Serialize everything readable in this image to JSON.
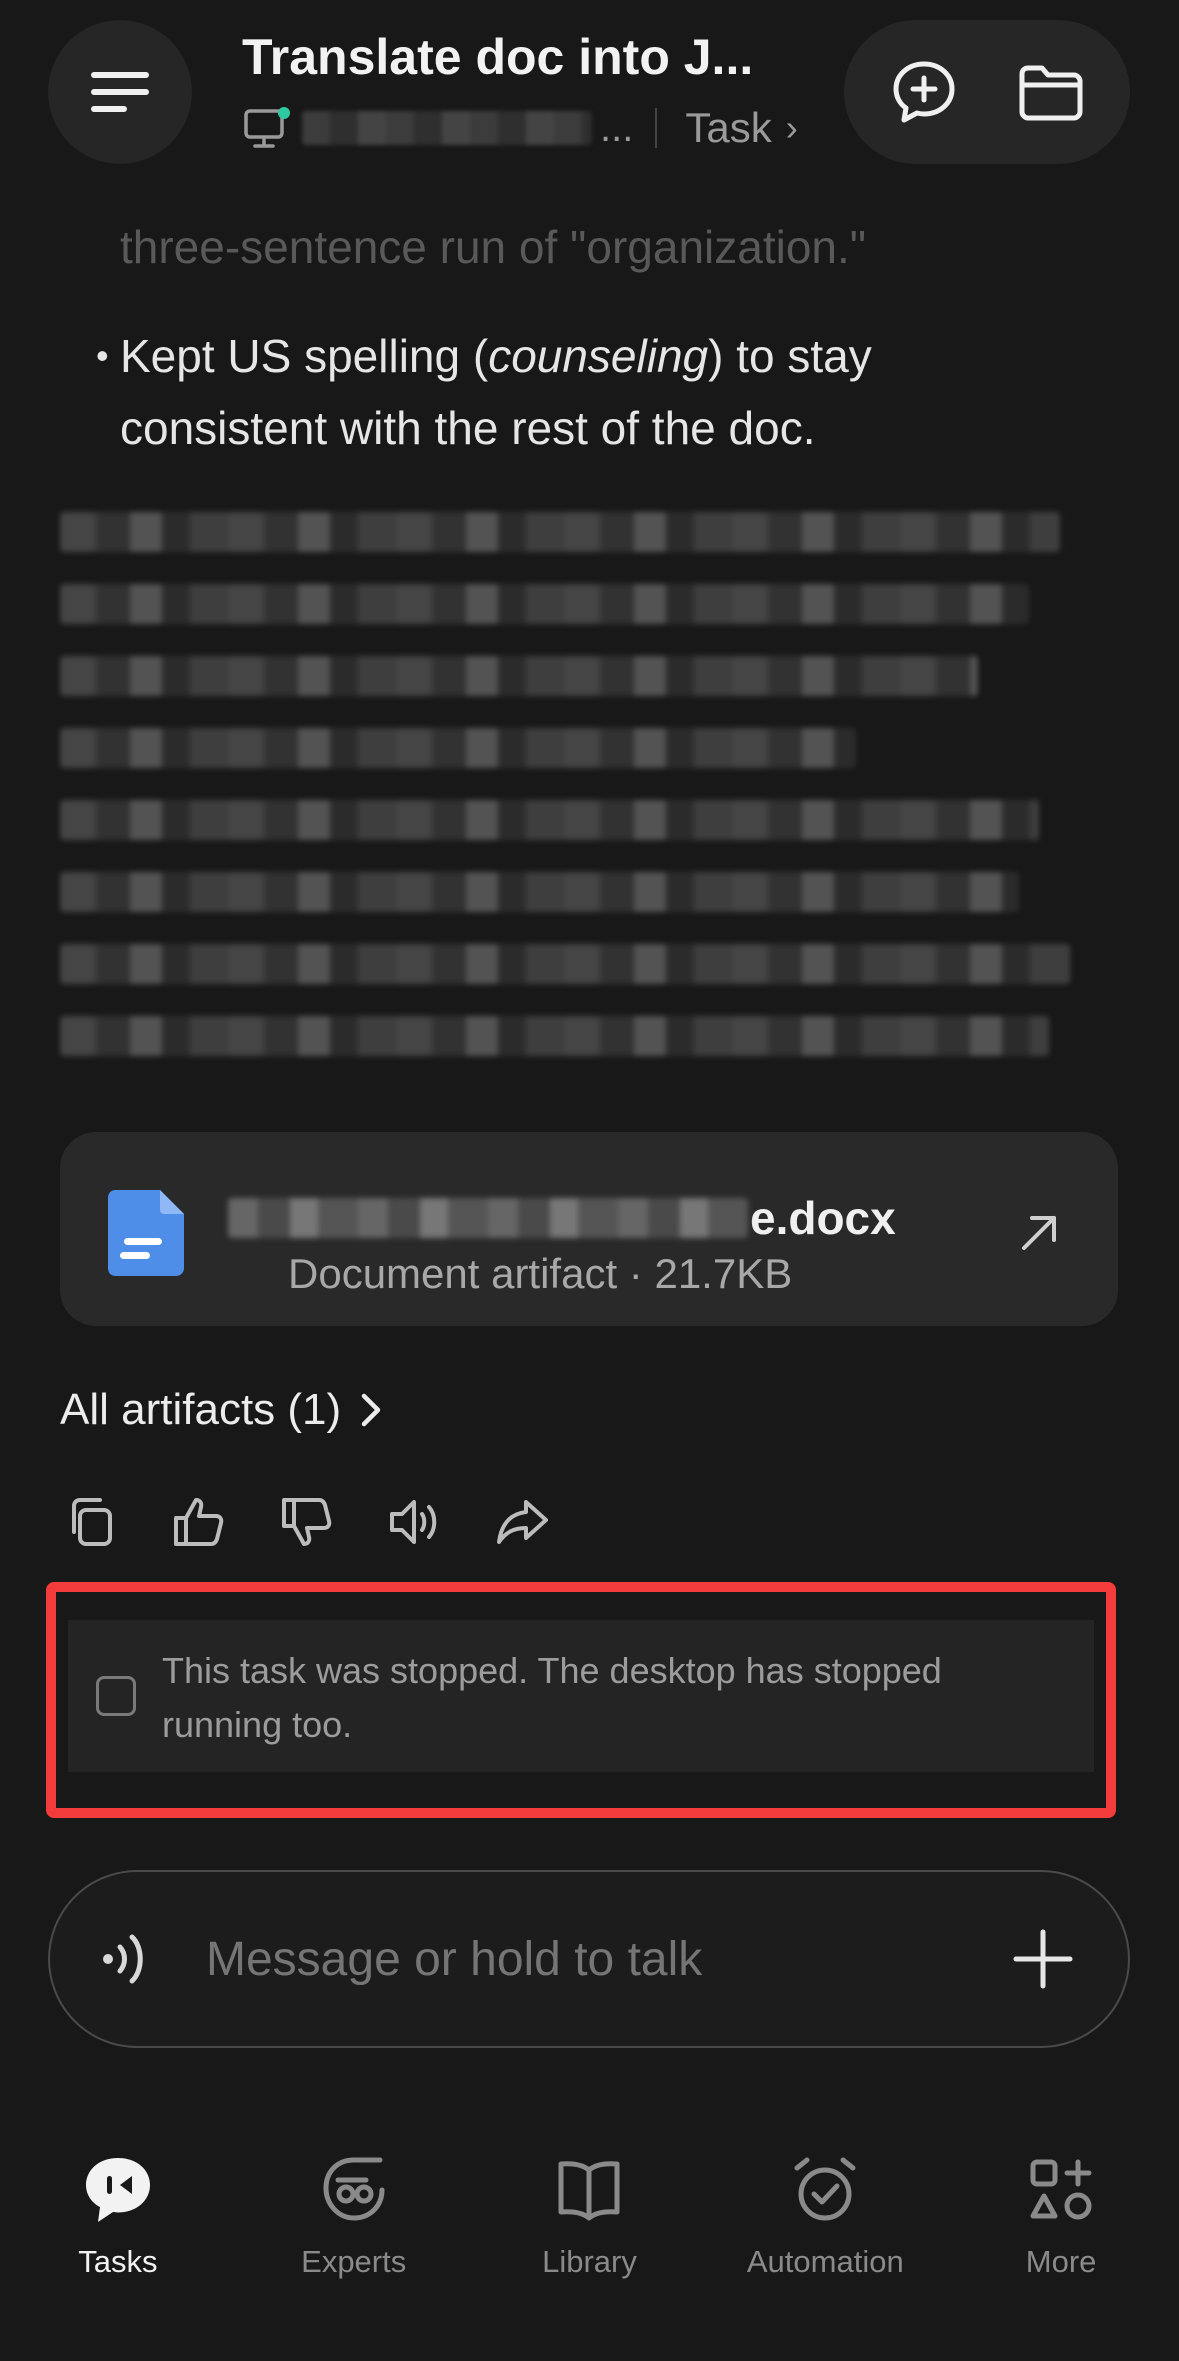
{
  "header": {
    "title": "Translate doc into J...",
    "subtitle_ellipsis": "...",
    "subtitle_task": "Task"
  },
  "message": {
    "faded_line": "three-sentence run of \"organization.\"",
    "bullet": {
      "before": "Kept US spelling (",
      "italic": "counseling",
      "after": ") to stay consistent with the rest of the doc."
    }
  },
  "artifact": {
    "name_suffix": "e.docx",
    "meta": "Document artifact · 21.7KB"
  },
  "all_artifacts_label": "All artifacts (1)",
  "stopped_notice": "This task was stopped. The desktop has stopped running too.",
  "composer": {
    "placeholder": "Message or hold to talk"
  },
  "nav": {
    "tasks": "Tasks",
    "experts": "Experts",
    "library": "Library",
    "automation": "Automation",
    "more": "More"
  },
  "colors": {
    "background": "#181818",
    "highlight": "#f33b3b",
    "doc_icon": "#4f8ee8",
    "online_dot": "#2ec9a0"
  }
}
